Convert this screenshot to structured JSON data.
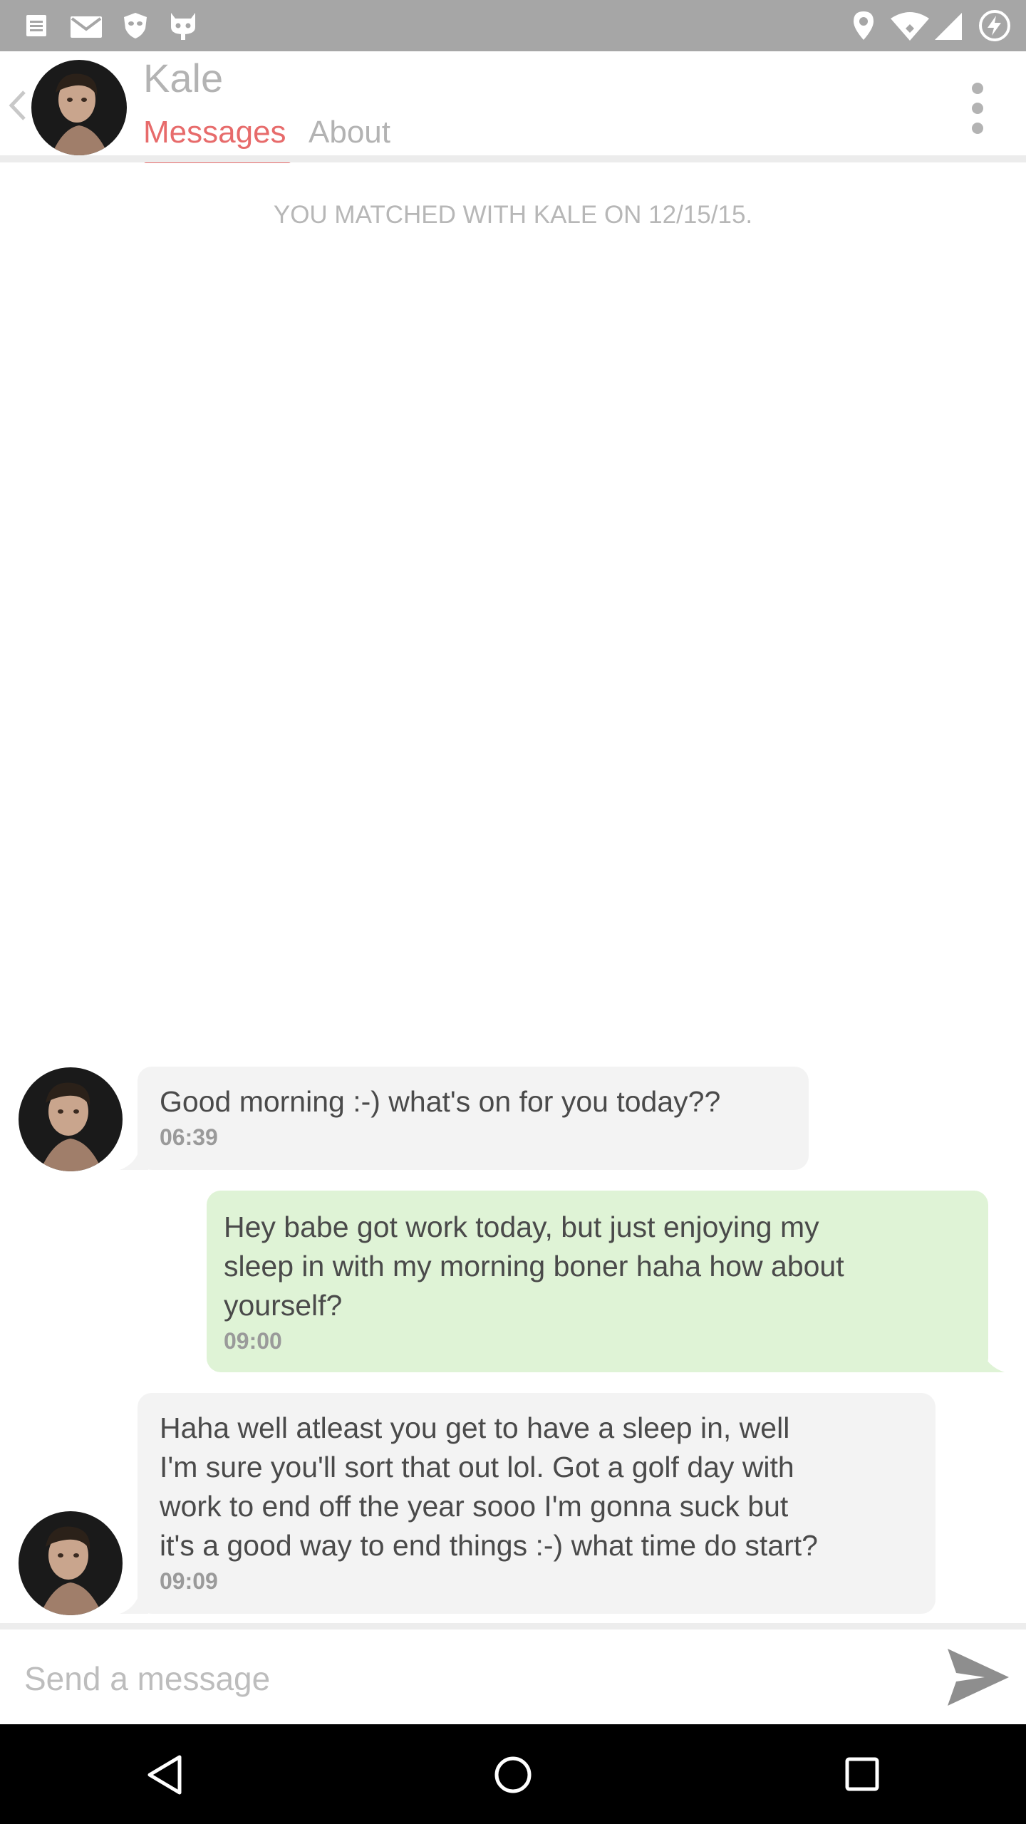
{
  "status_bar": {
    "left_icons": [
      "notes-icon",
      "mail-icon",
      "vpn-mask-icon",
      "android-bot-icon"
    ],
    "right_icons": [
      "location-pin-icon",
      "wifi-icon",
      "cell-signal-icon",
      "battery-charging-icon"
    ]
  },
  "header": {
    "name": "Kale",
    "tabs": [
      {
        "label": "Messages",
        "active": true
      },
      {
        "label": "About",
        "active": false
      }
    ],
    "accent_color": "#e76b6b"
  },
  "match_note": "YOU MATCHED WITH KALE ON 12/15/15.",
  "messages": [
    {
      "direction": "incoming",
      "lines": [
        "Good morning :-) what's on for you today??"
      ],
      "time": "06:39"
    },
    {
      "direction": "outgoing",
      "lines": [
        "Hey babe got work today, but just enjoying my",
        "sleep in with my morning boner haha how about",
        "yourself?"
      ],
      "time": "09:00"
    },
    {
      "direction": "incoming",
      "lines": [
        "Haha well atleast you get to have a sleep in, well",
        "I'm sure you'll sort that out lol. Got a golf day with",
        "work to end off the year sooo I'm gonna suck but",
        "it's a good way to end things :-) what time do start?"
      ],
      "time": "09:09"
    }
  ],
  "composer": {
    "placeholder": "Send a message"
  },
  "colors": {
    "incoming_bubble": "#f3f3f3",
    "outgoing_bubble": "#dff3d6",
    "status_bar": "#a6a6a6",
    "nav_bar": "#000000"
  }
}
